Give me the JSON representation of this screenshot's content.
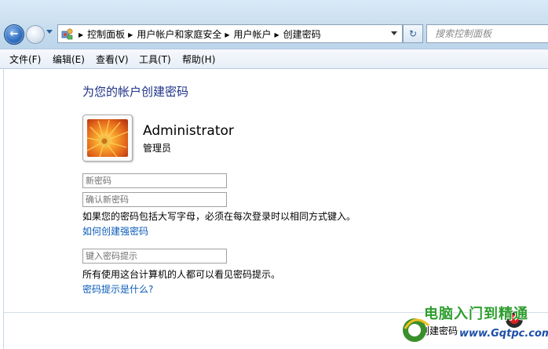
{
  "address_bar": {
    "breadcrumbs": [
      "控制面板",
      "用户帐户和家庭安全",
      "用户帐户",
      "创建密码"
    ],
    "search_placeholder": "搜索控制面板"
  },
  "menu": {
    "items": [
      "文件(F)",
      "编辑(E)",
      "查看(V)",
      "工具(T)",
      "帮助(H)"
    ]
  },
  "page": {
    "title": "为您的帐户创建密码",
    "user_name": "Administrator",
    "user_role": "管理员",
    "new_password_placeholder": "新密码",
    "confirm_password_placeholder": "确认新密码",
    "caps_note": "如果您的密码包括大写字母，必须在每次登录时以相同方式键入。",
    "strong_password_link": "如何创建强密码",
    "hint_placeholder": "键入密码提示",
    "hint_note": "所有使用这台计算机的人都可以看见密码提示。",
    "hint_link": "密码提示是什么?",
    "create_button_label": "创建密码"
  },
  "watermark": {
    "line1": "电脑入门到精通",
    "line2": "www.Gqtpc.com"
  },
  "colors": {
    "title": "#1e3287",
    "link": "#0b5bb8",
    "chrome": "#c8def0"
  },
  "icons": [
    "back-arrow-icon",
    "forward-arrow-icon",
    "control-panel-icon",
    "refresh-icon",
    "chevron-down-icon",
    "user-avatar-icon"
  ]
}
